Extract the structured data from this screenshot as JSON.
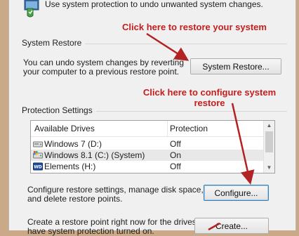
{
  "intro": {
    "text": "Use system protection to undo unwanted system changes."
  },
  "annotations": {
    "restore": "Click here to restore your system",
    "configure_line1": "Click here to configure system",
    "configure_line2": "restore"
  },
  "system_restore": {
    "group_label": "System Restore",
    "description_line1": "You can undo system changes by reverting",
    "description_line2": "your computer to a previous restore point.",
    "button_label": "System Restore..."
  },
  "protection_settings": {
    "group_label": "Protection Settings",
    "columns": [
      "Available Drives",
      "Protection"
    ],
    "drives": [
      {
        "name": "Windows 7 (D:)",
        "protection": "Off",
        "icon": "hard-drive-icon"
      },
      {
        "name": "Windows 8.1 (C:) (System)",
        "protection": "On",
        "icon": "system-drive-icon"
      },
      {
        "name": "Elements (H:)",
        "protection": "Off",
        "icon": "wd-drive-icon"
      }
    ],
    "configure_text_line1": "Configure restore settings, manage disk space,",
    "configure_text_line2": "and delete restore points.",
    "configure_button": "Configure...",
    "create_text_line1": "Create a restore point right now for the drives that",
    "create_text_line2": "have system protection turned on.",
    "create_button": "Create..."
  },
  "colors": {
    "annotation": "#c41d1d",
    "selected_row": "#e8e8e8",
    "outer_background": "#c9a987"
  }
}
